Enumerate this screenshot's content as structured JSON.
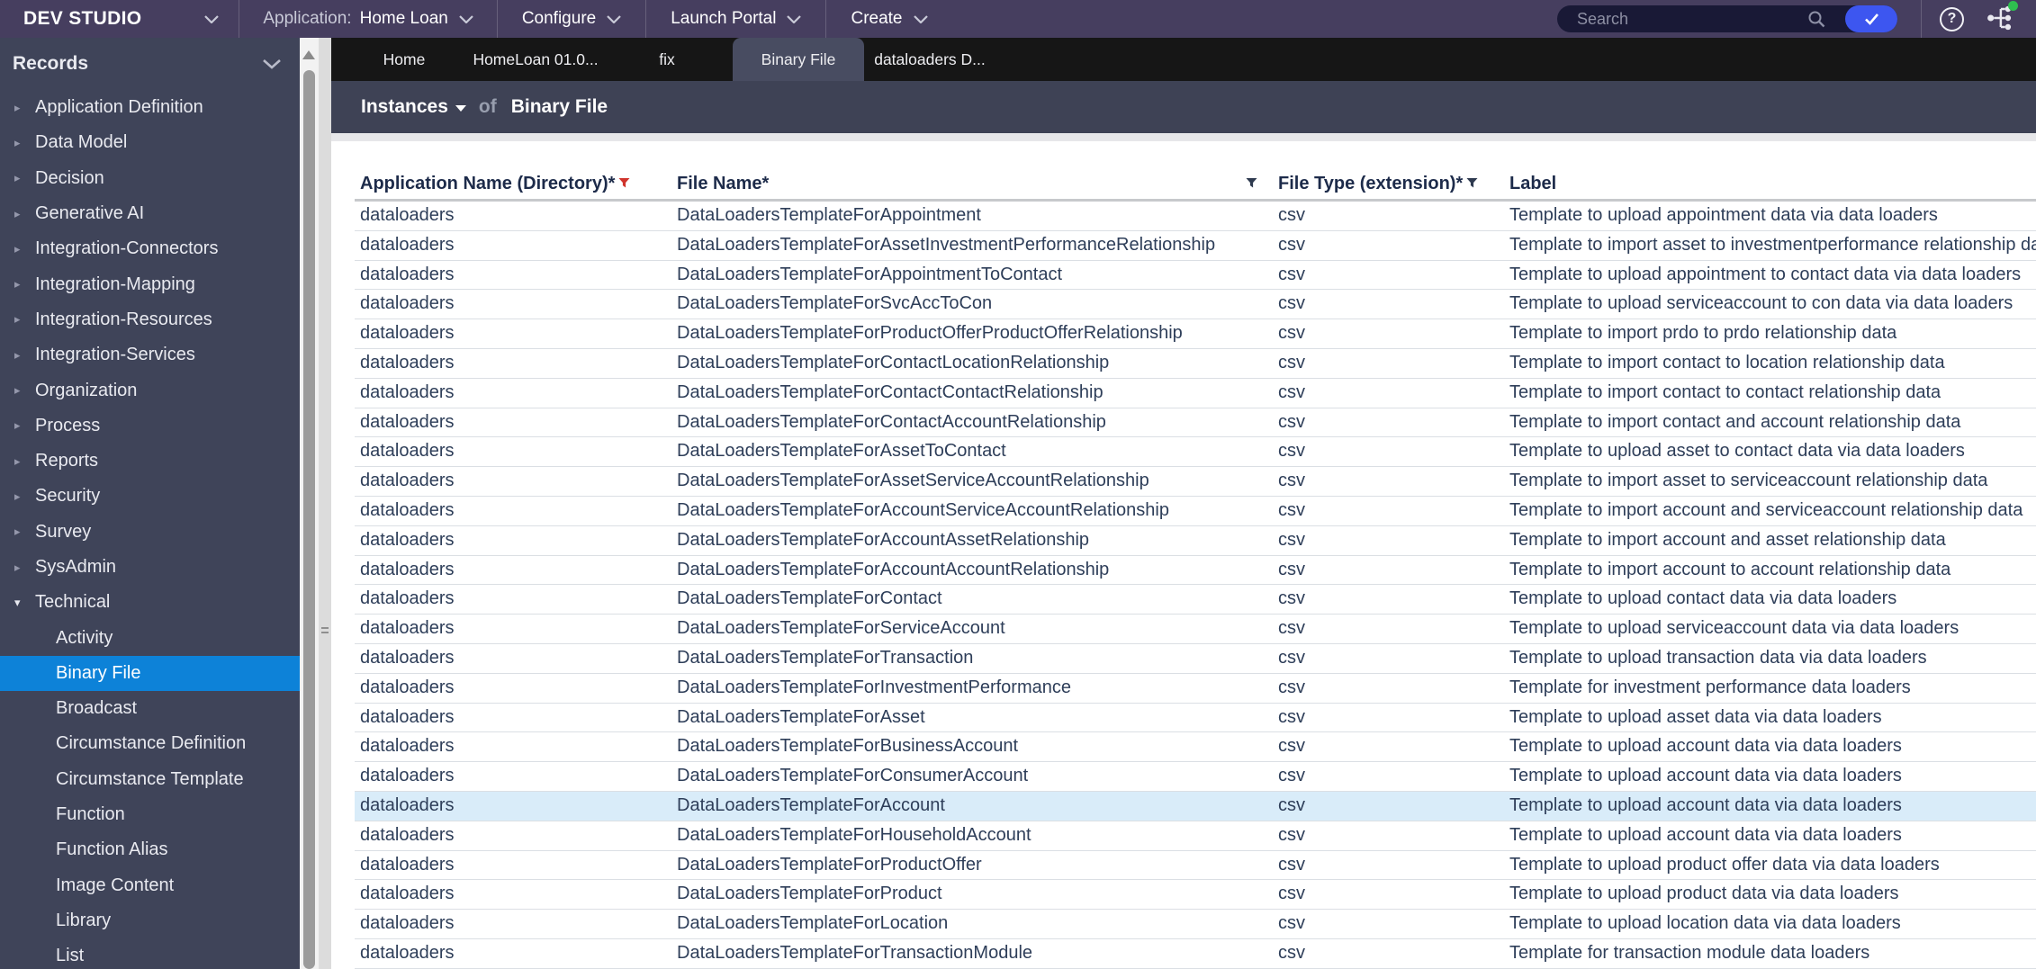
{
  "nav": {
    "brand": "DEV STUDIO",
    "application_label": "Application:",
    "application_value": "Home Loan",
    "menus": [
      "Configure",
      "Launch Portal",
      "Create"
    ],
    "search_placeholder": "Search",
    "icons": {
      "help_glyph": "?"
    }
  },
  "sidebar": {
    "title": "Records",
    "items": [
      {
        "label": "Application Definition",
        "level": 0,
        "state": "collapsed"
      },
      {
        "label": "Data Model",
        "level": 0,
        "state": "collapsed"
      },
      {
        "label": "Decision",
        "level": 0,
        "state": "collapsed"
      },
      {
        "label": "Generative AI",
        "level": 0,
        "state": "collapsed"
      },
      {
        "label": "Integration-Connectors",
        "level": 0,
        "state": "collapsed"
      },
      {
        "label": "Integration-Mapping",
        "level": 0,
        "state": "collapsed"
      },
      {
        "label": "Integration-Resources",
        "level": 0,
        "state": "collapsed"
      },
      {
        "label": "Integration-Services",
        "level": 0,
        "state": "collapsed"
      },
      {
        "label": "Organization",
        "level": 0,
        "state": "collapsed"
      },
      {
        "label": "Process",
        "level": 0,
        "state": "collapsed"
      },
      {
        "label": "Reports",
        "level": 0,
        "state": "collapsed"
      },
      {
        "label": "Security",
        "level": 0,
        "state": "collapsed"
      },
      {
        "label": "Survey",
        "level": 0,
        "state": "collapsed"
      },
      {
        "label": "SysAdmin",
        "level": 0,
        "state": "collapsed"
      },
      {
        "label": "Technical",
        "level": 0,
        "state": "expanded"
      },
      {
        "label": "Activity",
        "level": 1
      },
      {
        "label": "Binary File",
        "level": 1,
        "selected": true
      },
      {
        "label": "Broadcast",
        "level": 1
      },
      {
        "label": "Circumstance Definition",
        "level": 1
      },
      {
        "label": "Circumstance Template",
        "level": 1
      },
      {
        "label": "Function",
        "level": 1
      },
      {
        "label": "Function Alias",
        "level": 1
      },
      {
        "label": "Image Content",
        "level": 1
      },
      {
        "label": "Library",
        "level": 1
      },
      {
        "label": "List",
        "level": 1
      }
    ]
  },
  "tabs": [
    {
      "label": "Home",
      "active": false
    },
    {
      "label": "HomeLoan 01.0...",
      "active": false
    },
    {
      "label": "fix",
      "active": false
    },
    {
      "label": "Binary File",
      "active": true
    },
    {
      "label": "dataloaders D...",
      "active": false
    }
  ],
  "breadcrumb": {
    "instances": "Instances",
    "of": "of",
    "title": "Binary File"
  },
  "table": {
    "columns": [
      {
        "label": "Application Name (Directory)*",
        "filter": "red",
        "funnel": "inline"
      },
      {
        "label": "File Name*",
        "filter": "dark",
        "funnel": "right"
      },
      {
        "label": "File Type (extension)*",
        "filter": "dark",
        "funnel": "inline"
      },
      {
        "label": "Label",
        "filter": null,
        "funnel": null
      }
    ],
    "rows": [
      {
        "app": "dataloaders",
        "file": "DataLoadersTemplateForAppointment",
        "type": "csv",
        "label": "Template to upload appointment data via data loaders",
        "highlighted": false
      },
      {
        "app": "dataloaders",
        "file": "DataLoadersTemplateForAssetInvestmentPerformanceRelationship",
        "type": "csv",
        "label": "Template to import asset to investmentperformance relationship data",
        "highlighted": false
      },
      {
        "app": "dataloaders",
        "file": "DataLoadersTemplateForAppointmentToContact",
        "type": "csv",
        "label": "Template to upload appointment to contact data via data loaders",
        "highlighted": false
      },
      {
        "app": "dataloaders",
        "file": "DataLoadersTemplateForSvcAccToCon",
        "type": "csv",
        "label": "Template to upload serviceaccount to con data via data loaders",
        "highlighted": false
      },
      {
        "app": "dataloaders",
        "file": "DataLoadersTemplateForProductOfferProductOfferRelationship",
        "type": "csv",
        "label": "Template to import prdo to prdo relationship data",
        "highlighted": false
      },
      {
        "app": "dataloaders",
        "file": "DataLoadersTemplateForContactLocationRelationship",
        "type": "csv",
        "label": "Template to import contact to location relationship data",
        "highlighted": false
      },
      {
        "app": "dataloaders",
        "file": "DataLoadersTemplateForContactContactRelationship",
        "type": "csv",
        "label": "Template to import contact to contact relationship data",
        "highlighted": false
      },
      {
        "app": "dataloaders",
        "file": "DataLoadersTemplateForContactAccountRelationship",
        "type": "csv",
        "label": "Template to import contact and account relationship data",
        "highlighted": false
      },
      {
        "app": "dataloaders",
        "file": "DataLoadersTemplateForAssetToContact",
        "type": "csv",
        "label": "Template to upload asset to contact data via data loaders",
        "highlighted": false
      },
      {
        "app": "dataloaders",
        "file": "DataLoadersTemplateForAssetServiceAccountRelationship",
        "type": "csv",
        "label": "Template to import asset to serviceaccount relationship data",
        "highlighted": false
      },
      {
        "app": "dataloaders",
        "file": "DataLoadersTemplateForAccountServiceAccountRelationship",
        "type": "csv",
        "label": "Template to import account and serviceaccount relationship data",
        "highlighted": false
      },
      {
        "app": "dataloaders",
        "file": "DataLoadersTemplateForAccountAssetRelationship",
        "type": "csv",
        "label": "Template to import account and asset relationship data",
        "highlighted": false
      },
      {
        "app": "dataloaders",
        "file": "DataLoadersTemplateForAccountAccountRelationship",
        "type": "csv",
        "label": "Template to import account to account relationship data",
        "highlighted": false
      },
      {
        "app": "dataloaders",
        "file": "DataLoadersTemplateForContact",
        "type": "csv",
        "label": "Template to upload contact data via data loaders",
        "highlighted": false
      },
      {
        "app": "dataloaders",
        "file": "DataLoadersTemplateForServiceAccount",
        "type": "csv",
        "label": "Template to upload serviceaccount data via data loaders",
        "highlighted": false
      },
      {
        "app": "dataloaders",
        "file": "DataLoadersTemplateForTransaction",
        "type": "csv",
        "label": "Template to upload transaction data via data loaders",
        "highlighted": false
      },
      {
        "app": "dataloaders",
        "file": "DataLoadersTemplateForInvestmentPerformance",
        "type": "csv",
        "label": "Template for investment performance data loaders",
        "highlighted": false
      },
      {
        "app": "dataloaders",
        "file": "DataLoadersTemplateForAsset",
        "type": "csv",
        "label": "Template to upload asset data via data loaders",
        "highlighted": false
      },
      {
        "app": "dataloaders",
        "file": "DataLoadersTemplateForBusinessAccount",
        "type": "csv",
        "label": "Template to upload account data via data loaders",
        "highlighted": false
      },
      {
        "app": "dataloaders",
        "file": "DataLoadersTemplateForConsumerAccount",
        "type": "csv",
        "label": "Template to upload account data via data loaders",
        "highlighted": false
      },
      {
        "app": "dataloaders",
        "file": "DataLoadersTemplateForAccount",
        "type": "csv",
        "label": "Template to upload account data via data loaders",
        "highlighted": true
      },
      {
        "app": "dataloaders",
        "file": "DataLoadersTemplateForHouseholdAccount",
        "type": "csv",
        "label": "Template to upload account data via data loaders",
        "highlighted": false
      },
      {
        "app": "dataloaders",
        "file": "DataLoadersTemplateForProductOffer",
        "type": "csv",
        "label": "Template to upload product offer data via data loaders",
        "highlighted": false
      },
      {
        "app": "dataloaders",
        "file": "DataLoadersTemplateForProduct",
        "type": "csv",
        "label": "Template to upload product data via data loaders",
        "highlighted": false
      },
      {
        "app": "dataloaders",
        "file": "DataLoadersTemplateForLocation",
        "type": "csv",
        "label": "Template to upload location data via data loaders",
        "highlighted": false
      },
      {
        "app": "dataloaders",
        "file": "DataLoadersTemplateForTransactionModule",
        "type": "csv",
        "label": "Template for transaction module data loaders",
        "highlighted": false
      }
    ]
  },
  "colors": {
    "nav_bg": "#463e5f",
    "sidebar_bg": "#3f4459",
    "instances_bg": "#3e4255",
    "tabbar_bg": "#161616",
    "active_tab_bg": "#484c61",
    "selected_blue": "#0d82d8",
    "row_highlight": "#d9ecf9",
    "filter_active_red": "#d0342c",
    "check_button_blue": "#3d56f0",
    "status_green": "#2fbf4f"
  }
}
